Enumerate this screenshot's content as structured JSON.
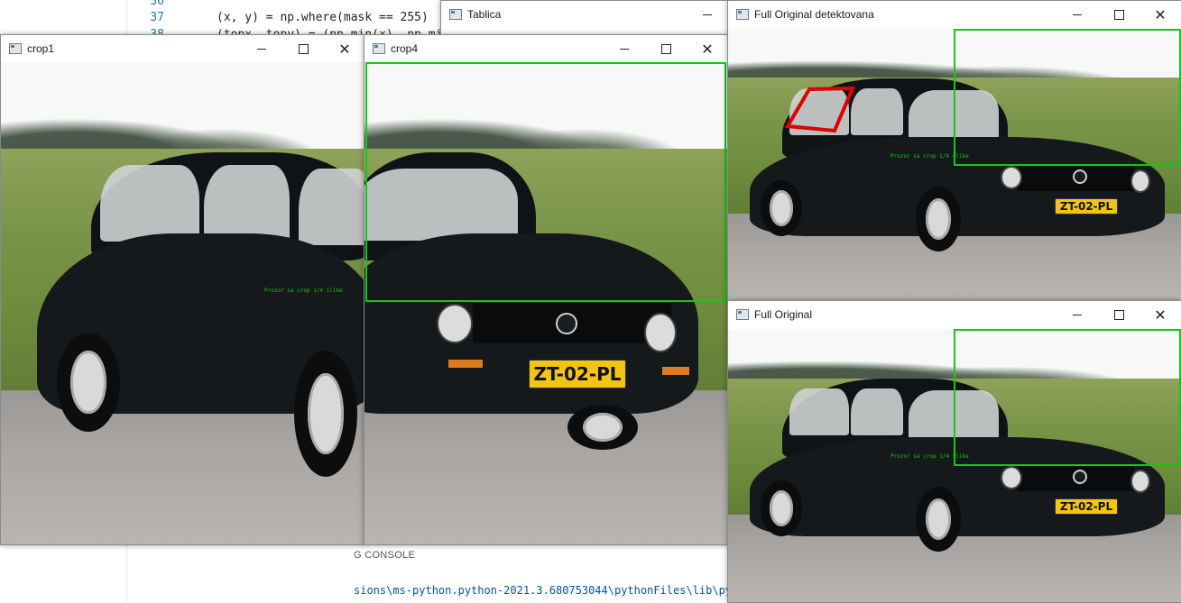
{
  "editor": {
    "line_numbers": [
      "36",
      "37",
      "38"
    ],
    "code_lines": [
      "(x, y) = np.where(mask == 255)",
      "(topx, topy) = (np.min(x), np.mi"
    ],
    "panel_tab_label": "G CONSOLE",
    "terminal_text": "sions\\ms-python.python-2021.3.680753044\\pythonFiles\\lib\\pyt"
  },
  "windows": {
    "tablica": {
      "title": "Tablica"
    },
    "crop1": {
      "title": "crop1",
      "overlay_text": "Prozor sa crop 1/4 slike"
    },
    "crop4": {
      "title": "crop4"
    },
    "full_detected": {
      "title": "Full Original detektovana",
      "overlay_text": "Prozor sa crop 1/4 slike"
    },
    "full_original": {
      "title": "Full Original",
      "overlay_text": "Prozor sa crop 1/4 slike"
    }
  },
  "plate_text": "ZT-02-PL",
  "colors": {
    "detection_green": "#17c617",
    "detection_red": "#e00000",
    "plate_yellow": "#f2c514"
  },
  "icons": [
    "window-app-icon",
    "minimize-icon",
    "maximize-icon",
    "close-icon"
  ]
}
